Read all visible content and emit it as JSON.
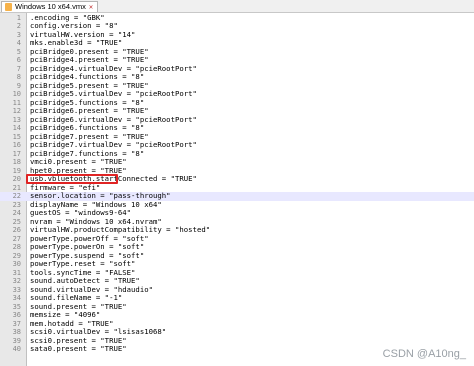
{
  "tab": {
    "title": "Windows 10 x64.vmx",
    "close_glyph": "✕"
  },
  "current_line": 22,
  "lines": [
    ".encoding = \"GBK\"",
    "config.version = \"8\"",
    "virtualHW.version = \"14\"",
    "mks.enable3d = \"TRUE\"",
    "pciBridge0.present = \"TRUE\"",
    "pciBridge4.present = \"TRUE\"",
    "pciBridge4.virtualDev = \"pcieRootPort\"",
    "pciBridge4.functions = \"8\"",
    "pciBridge5.present = \"TRUE\"",
    "pciBridge5.virtualDev = \"pcieRootPort\"",
    "pciBridge5.functions = \"8\"",
    "pciBridge6.present = \"TRUE\"",
    "pciBridge6.virtualDev = \"pcieRootPort\"",
    "pciBridge6.functions = \"8\"",
    "pciBridge7.present = \"TRUE\"",
    "pciBridge7.virtualDev = \"pcieRootPort\"",
    "pciBridge7.functions = \"8\"",
    "vmci0.present = \"TRUE\"",
    "hpet0.present = \"TRUE\"",
    "usb.vbluetooth.startConnected = \"TRUE\"",
    "firmware = \"efi\"",
    "sensor.location = \"pass-through\"",
    "displayName = \"Windows 10 x64\"",
    "guestOS = \"windows9-64\"",
    "nvram = \"Windows 10 x64.nvram\"",
    "virtualHW.productCompatibility = \"hosted\"",
    "powerType.powerOff = \"soft\"",
    "powerType.powerOn = \"soft\"",
    "powerType.suspend = \"soft\"",
    "powerType.reset = \"soft\"",
    "tools.syncTime = \"FALSE\"",
    "sound.autoDetect = \"TRUE\"",
    "sound.virtualDev = \"hdaudio\"",
    "sound.fileName = \"-1\"",
    "sound.present = \"TRUE\"",
    "memsize = \"4096\"",
    "mem.hotadd = \"TRUE\"",
    "scsi0.virtualDev = \"lsisas1068\"",
    "scsi0.present = \"TRUE\"",
    "sata0.present = \"TRUE\""
  ],
  "watermark": "CSDN @A10ng_"
}
